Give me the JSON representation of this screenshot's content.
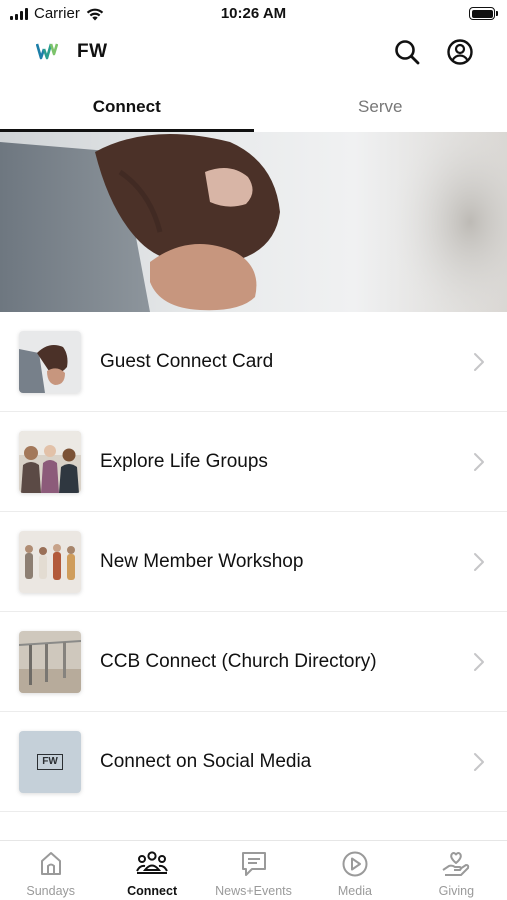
{
  "status_bar": {
    "carrier": "Carrier",
    "time": "10:26 AM"
  },
  "header": {
    "title": "FW"
  },
  "tabs": [
    {
      "label": "Connect",
      "active": true
    },
    {
      "label": "Serve",
      "active": false
    }
  ],
  "list": [
    {
      "label": "Guest Connect Card",
      "thumb": "handshake"
    },
    {
      "label": "Explore Life Groups",
      "thumb": "group"
    },
    {
      "label": "New Member Workshop",
      "thumb": "people-walking"
    },
    {
      "label": "CCB Connect (Church Directory)",
      "thumb": "railing"
    },
    {
      "label": "Connect on Social Media",
      "thumb": "fw-logo",
      "thumb_text": "FW"
    }
  ],
  "bottom_nav": [
    {
      "label": "Sundays",
      "icon": "church-icon",
      "active": false
    },
    {
      "label": "Connect",
      "icon": "people-icon",
      "active": true
    },
    {
      "label": "News+Events",
      "icon": "message-icon",
      "active": false
    },
    {
      "label": "Media",
      "icon": "play-icon",
      "active": false
    },
    {
      "label": "Giving",
      "icon": "giving-hand-icon",
      "active": false
    }
  ],
  "colors": {
    "active": "#111111",
    "inactive": "#9a9a9a",
    "accent_logo": "#2a9d8f"
  }
}
